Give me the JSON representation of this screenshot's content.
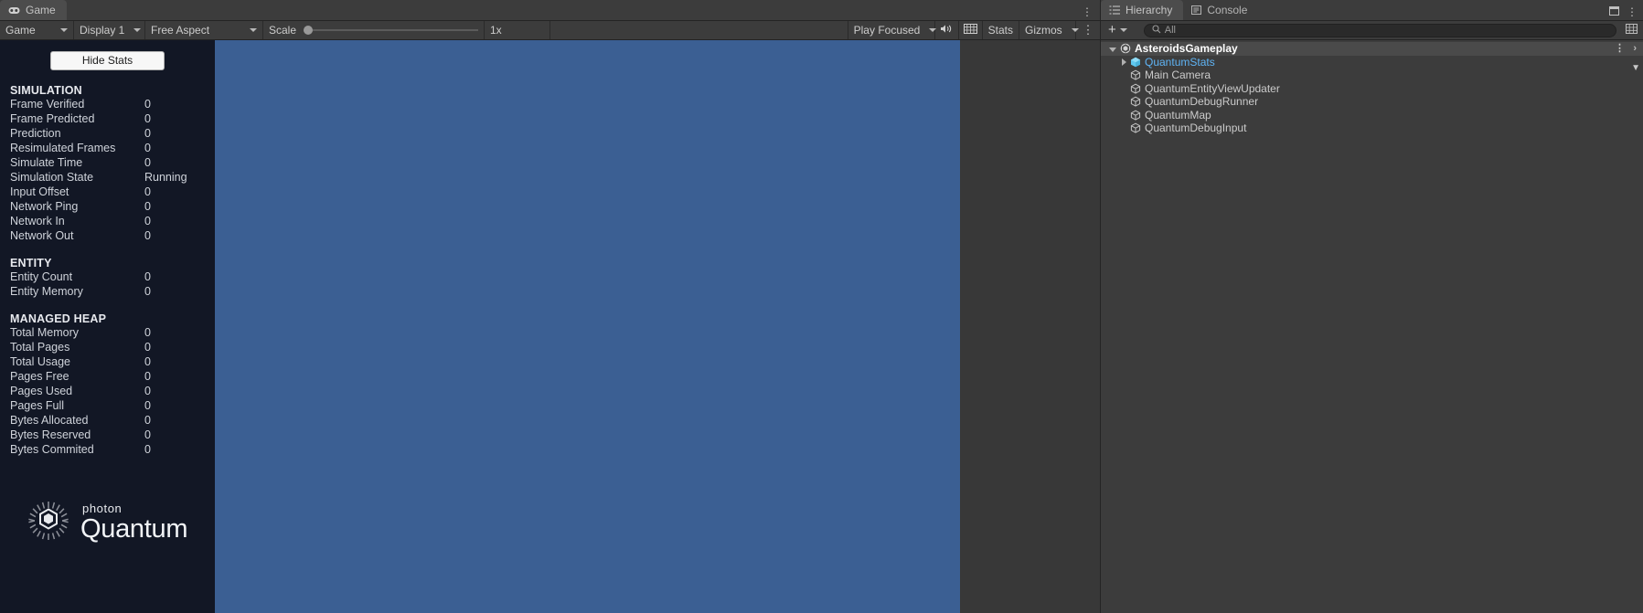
{
  "game_panel": {
    "tab": {
      "label": "Game",
      "icon": "gamepad-icon"
    },
    "overflow_icon": "kebab-menu-icon",
    "toolbar": {
      "view_dropdown": "Game",
      "display_dropdown": "Display 1",
      "aspect_dropdown": "Free Aspect",
      "scale_label": "Scale",
      "scale_value": "1x",
      "play_mode_dropdown": "Play Focused",
      "mute_icon": "speaker-icon",
      "aspect_grid_icon": "grid-icon",
      "stats_button": "Stats",
      "gizmos_button": "Gizmos",
      "gizmos_caret_icon": "chevron-down-icon",
      "options_icon": "kebab-menu-icon"
    },
    "viewport_color": "#3b5f93"
  },
  "stats_overlay": {
    "hide_button": "Hide Stats",
    "background_color": "#121725",
    "sections": [
      {
        "title": "SIMULATION",
        "rows": [
          {
            "label": "Frame Verified",
            "value": "0"
          },
          {
            "label": "Frame Predicted",
            "value": "0"
          },
          {
            "label": "Prediction",
            "value": "0"
          },
          {
            "label": "Resimulated Frames",
            "value": "0"
          },
          {
            "label": "Simulate Time",
            "value": "0"
          },
          {
            "label": "Simulation State",
            "value": "Running"
          },
          {
            "label": "Input Offset",
            "value": "0"
          },
          {
            "label": "Network Ping",
            "value": "0"
          },
          {
            "label": "Network In",
            "value": "0"
          },
          {
            "label": "Network Out",
            "value": "0"
          }
        ]
      },
      {
        "title": "ENTITY",
        "rows": [
          {
            "label": "Entity Count",
            "value": "0"
          },
          {
            "label": "Entity Memory",
            "value": "0"
          }
        ]
      },
      {
        "title": "MANAGED HEAP",
        "rows": [
          {
            "label": "Total Memory",
            "value": "0"
          },
          {
            "label": "Total Pages",
            "value": "0"
          },
          {
            "label": "Total Usage",
            "value": "0"
          },
          {
            "label": "Pages Free",
            "value": "0"
          },
          {
            "label": "Pages Used",
            "value": "0"
          },
          {
            "label": "Pages Full",
            "value": "0"
          },
          {
            "label": "Bytes Allocated",
            "value": "0"
          },
          {
            "label": "Bytes Reserved",
            "value": "0"
          },
          {
            "label": "Bytes Commited",
            "value": "0"
          }
        ]
      }
    ],
    "logo": {
      "top": "photon",
      "bottom": "Quantum",
      "icon": "photon-quantum-logo-icon"
    }
  },
  "hierarchy_panel": {
    "tabs": [
      {
        "label": "Hierarchy",
        "icon": "hierarchy-icon",
        "active": true
      },
      {
        "label": "Console",
        "icon": "console-icon",
        "active": false
      }
    ],
    "toolbar": {
      "add_label": "+",
      "add_caret_icon": "chevron-down-icon",
      "search_placeholder": "All",
      "search_value": "",
      "search_icon": "search-icon",
      "layers_icon": "layers-icon"
    },
    "tree": [
      {
        "label": "AsteroidsGameplay",
        "depth": 0,
        "icon": "unity-scene-icon",
        "expanded": true,
        "selected": false,
        "is_scene": true
      },
      {
        "label": "QuantumStats",
        "depth": 1,
        "icon": "prefab-icon",
        "expanded": false,
        "selected": true,
        "is_scene": false
      },
      {
        "label": "Main Camera",
        "depth": 1,
        "icon": "gameobject-icon",
        "expanded": null,
        "selected": false,
        "is_scene": false
      },
      {
        "label": "QuantumEntityViewUpdater",
        "depth": 1,
        "icon": "gameobject-icon",
        "expanded": null,
        "selected": false,
        "is_scene": false
      },
      {
        "label": "QuantumDebugRunner",
        "depth": 1,
        "icon": "gameobject-icon",
        "expanded": null,
        "selected": false,
        "is_scene": false
      },
      {
        "label": "QuantumMap",
        "depth": 1,
        "icon": "gameobject-icon",
        "expanded": null,
        "selected": false,
        "is_scene": false
      },
      {
        "label": "QuantumDebugInput",
        "depth": 1,
        "icon": "gameobject-icon",
        "expanded": null,
        "selected": false,
        "is_scene": false
      }
    ],
    "scene_row_menu_icon": "kebab-menu-icon",
    "scene_row_chevron_icon": "chevron-right-icon",
    "window_maximize_icon": "maximize-icon",
    "window_menu_icon": "kebab-menu-icon"
  }
}
